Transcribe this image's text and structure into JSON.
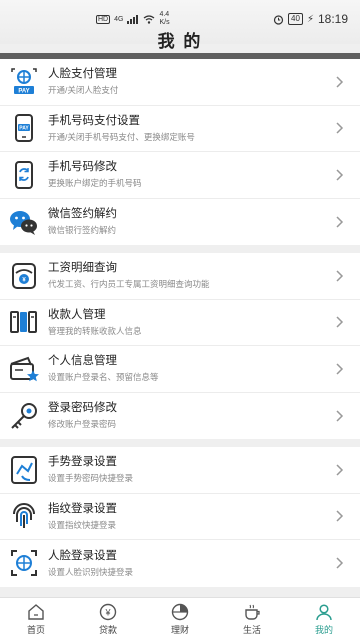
{
  "status_bar": {
    "left_badges": [
      "HD",
      "4G"
    ],
    "speed": "4.4",
    "speed_unit": "K/s",
    "battery": "40",
    "time": "18:19"
  },
  "header": {
    "title": "我 的"
  },
  "groups": [
    {
      "items": [
        {
          "title": "人脸支付管理",
          "subtitle": "开通/关闭人脸支付",
          "icon": "face-pay-icon"
        },
        {
          "title": "手机号码支付设置",
          "subtitle": "开通/关闭手机号码支付、更换绑定账号",
          "icon": "phone-pay-icon"
        },
        {
          "title": "手机号码修改",
          "subtitle": "更换账户绑定的手机号码",
          "icon": "phone-change-icon"
        },
        {
          "title": "微信签约解约",
          "subtitle": "微信银行签约解约",
          "icon": "wechat-icon"
        }
      ]
    },
    {
      "items": [
        {
          "title": "工资明细查询",
          "subtitle": "代发工资、行内员工专属工资明细查询功能",
          "icon": "salary-icon"
        },
        {
          "title": "收款人管理",
          "subtitle": "管理我的转账收款人信息",
          "icon": "payee-icon"
        },
        {
          "title": "个人信息管理",
          "subtitle": "设置账户登录名、预留信息等",
          "icon": "profile-icon"
        },
        {
          "title": "登录密码修改",
          "subtitle": "修改账户登录密码",
          "icon": "key-icon"
        }
      ]
    },
    {
      "items": [
        {
          "title": "手势登录设置",
          "subtitle": "设置手势密码快捷登录",
          "icon": "gesture-icon"
        },
        {
          "title": "指纹登录设置",
          "subtitle": "设置指纹快捷登录",
          "icon": "fingerprint-icon"
        },
        {
          "title": "人脸登录设置",
          "subtitle": "设置人脸识别快捷登录",
          "icon": "face-login-icon"
        }
      ]
    }
  ],
  "tabbar": {
    "tabs": [
      {
        "label": "首页",
        "icon": "home-icon"
      },
      {
        "label": "贷款",
        "icon": "loan-icon"
      },
      {
        "label": "理财",
        "icon": "wealth-icon"
      },
      {
        "label": "生活",
        "icon": "life-icon"
      },
      {
        "label": "我的",
        "icon": "mine-icon",
        "active": true
      }
    ]
  },
  "colors": {
    "accent": "#2a9d8f",
    "icon_blue": "#1e7fd6",
    "header_bar": "#5f5f5f"
  }
}
